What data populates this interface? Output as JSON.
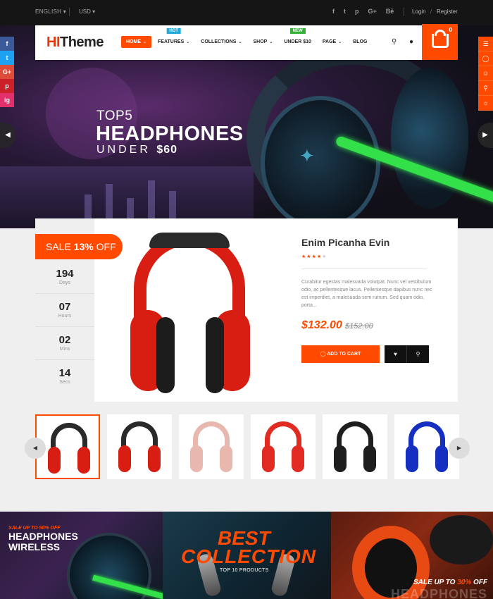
{
  "topbar": {
    "language": "ENGLISH",
    "currency": "USD",
    "social": [
      "f",
      "t",
      "p",
      "G+",
      "Bē"
    ],
    "login": "Login",
    "slash": "/",
    "register": "Register"
  },
  "header": {
    "brand_hi": "HI",
    "brand_theme": "Theme",
    "nav": [
      {
        "label": "HOME",
        "chevron": "⌄"
      },
      {
        "label": "FEATURES",
        "chevron": "⌄",
        "badge": "HOT"
      },
      {
        "label": "COLLECTIONS",
        "chevron": "⌄"
      },
      {
        "label": "SHOP",
        "chevron": "⌄"
      },
      {
        "label": "UNDER $10",
        "badge": "NEW"
      },
      {
        "label": "PAGE",
        "chevron": "⌄"
      },
      {
        "label": "BLOG"
      }
    ],
    "cart_count": "0"
  },
  "side_social": [
    "f",
    "t",
    "G+",
    "p",
    "ig"
  ],
  "side_tools": [
    "sliders-icon",
    "cart-icon",
    "users-icon",
    "search-icon",
    "sun-icon"
  ],
  "hero": {
    "top5": "TOP5",
    "headline": "HEADPHONES",
    "under": "UNDER",
    "price": "$60"
  },
  "deal": {
    "sale_prefix": "SALE",
    "sale_percent": "13%",
    "sale_suffix": "OFF",
    "countdown": [
      {
        "value": "194",
        "unit": "Days"
      },
      {
        "value": "07",
        "unit": "Hours"
      },
      {
        "value": "02",
        "unit": "Mins"
      },
      {
        "value": "14",
        "unit": "Secs"
      }
    ],
    "product_name": "Enim Picanha Evin",
    "rating": 4,
    "rating_max": 5,
    "description": "Curabitur egestas malesuada volutpat. Nunc vel vestibulum odio, ac pellentesque lacus. Pellentesque dapibus nunc nec est imperdiet, a malesuada sem rutrum. Sed quam odio, porta...",
    "price": "$132.00",
    "old_price": "$152.00",
    "add_to_cart": "ADD TO CART"
  },
  "thumbnails": [
    {
      "color": "#d81e12"
    },
    {
      "color": "#d81e12"
    },
    {
      "color": "#e8b7ae"
    },
    {
      "color": "#e02a22"
    },
    {
      "color": "#1e1e1e"
    },
    {
      "color": "#1530c0"
    }
  ],
  "banners": {
    "b1_sale": "SALE UP TO 50% OFF",
    "b1_line1": "HEADPHONES",
    "b1_line2": "WIRELESS",
    "b2_line1": "BEST",
    "b2_line2": "COLLECTION",
    "b2_sub": "TOP 10 PRODUCTS",
    "b3_sale_prefix": "SALE UP TO",
    "b3_sale_percent": "30%",
    "b3_sale_suffix": "OFF",
    "b3_ghost": "HEADPHONES"
  },
  "colors": {
    "accent": "#ff4a00",
    "hot_badge": "#25a9d8",
    "new_badge": "#35b13a",
    "facebook": "#3b5998",
    "twitter": "#1da1f2",
    "google": "#dd4b39",
    "pinterest": "#cb2027",
    "instagram": "#e1306c"
  }
}
